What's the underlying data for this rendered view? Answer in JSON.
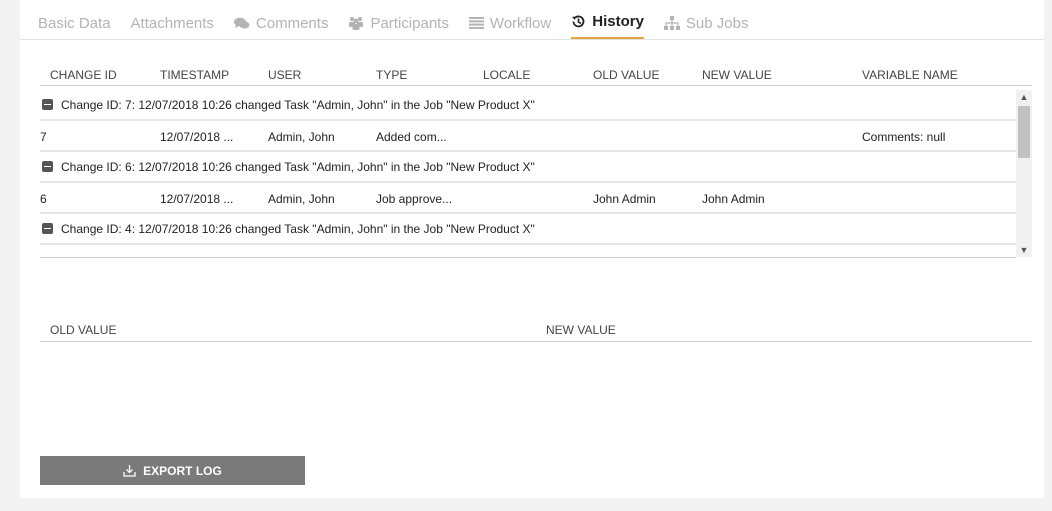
{
  "tabs": [
    {
      "label": "Basic Data",
      "icon": ""
    },
    {
      "label": "Attachments",
      "icon": ""
    },
    {
      "label": "Comments",
      "icon": "comments-icon"
    },
    {
      "label": "Participants",
      "icon": "participants-icon"
    },
    {
      "label": "Workflow",
      "icon": "workflow-icon"
    },
    {
      "label": "History",
      "icon": "history-icon",
      "active": true
    },
    {
      "label": "Sub Jobs",
      "icon": "sitemap-icon"
    }
  ],
  "table": {
    "columns": [
      "CHANGE ID",
      "TIMESTAMP",
      "USER",
      "TYPE",
      "LOCALE",
      "OLD VALUE",
      "NEW VALUE",
      "VARIABLE NAME"
    ],
    "groups": [
      {
        "header": "Change ID: 7: 12/07/2018 10:26 changed Task \"Admin, John\" in the Job \"New Product X\"",
        "row": {
          "change_id": "7",
          "timestamp": "12/07/2018 ...",
          "user": "Admin, John",
          "type": "Added com...",
          "locale": "",
          "old_value": "",
          "new_value": "",
          "variable_name": "Comments: null"
        }
      },
      {
        "header": "Change ID: 6: 12/07/2018 10:26 changed Task \"Admin, John\" in the Job \"New Product X\"",
        "row": {
          "change_id": "6",
          "timestamp": "12/07/2018 ...",
          "user": "Admin, John",
          "type": "Job approve...",
          "locale": "",
          "old_value": "John Admin",
          "new_value": "John Admin",
          "variable_name": ""
        }
      },
      {
        "header": "Change ID: 4: 12/07/2018 10:26 changed Task \"Admin, John\" in the Job \"New Product X\""
      }
    ]
  },
  "detail": {
    "old_value_label": "OLD VALUE",
    "new_value_label": "NEW VALUE"
  },
  "export": {
    "label": "EXPORT LOG",
    "icon": "download-icon"
  },
  "colors": {
    "active_tab_underline": "#e8a33d",
    "button_bg": "#7a7a7a"
  }
}
